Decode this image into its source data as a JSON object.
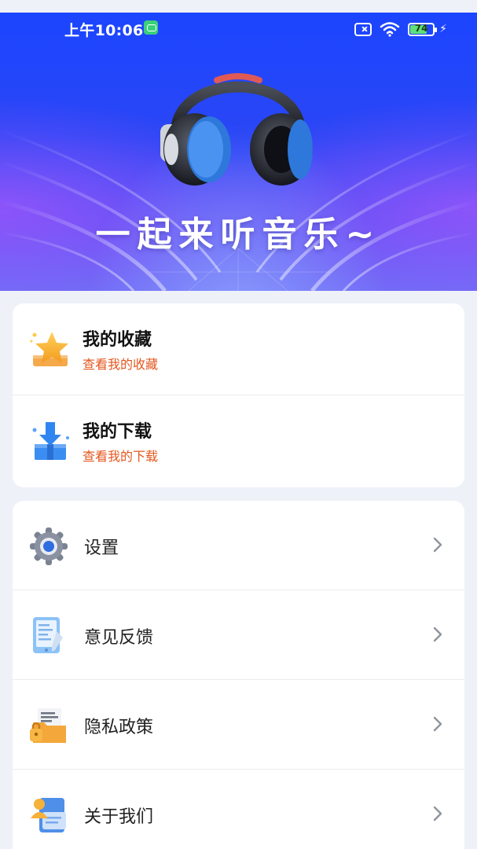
{
  "status_bar": {
    "time": "上午10:06",
    "battery": "74"
  },
  "banner": {
    "title": "一起来听音乐~"
  },
  "quick_links": [
    {
      "title": "我的收藏",
      "subtitle": "查看我的收藏",
      "icon": "star-icon"
    },
    {
      "title": "我的下载",
      "subtitle": "查看我的下载",
      "icon": "download-icon"
    }
  ],
  "menu": [
    {
      "label": "设置",
      "icon": "gear-icon"
    },
    {
      "label": "意见反馈",
      "icon": "feedback-icon"
    },
    {
      "label": "隐私政策",
      "icon": "privacy-icon"
    },
    {
      "label": "关于我们",
      "icon": "about-icon"
    }
  ],
  "colors": {
    "accent_orange": "#e4571f",
    "banner_blue": "#2a46f5",
    "page_bg": "#eef1f8"
  }
}
